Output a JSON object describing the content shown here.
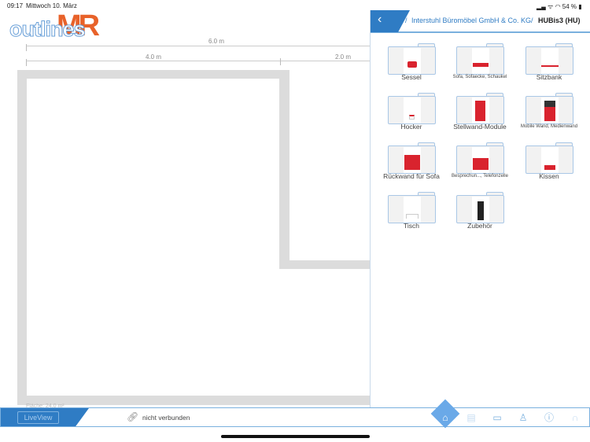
{
  "status_bar": {
    "time": "09:17",
    "date": "Mittwoch 10. März",
    "battery": "54 %"
  },
  "logo": {
    "text": "outlinesMR"
  },
  "dimensions": {
    "total": "6.0 m",
    "left": "4.0 m",
    "right": "2.0 m"
  },
  "area_label": "Fläche: 24.0 m²",
  "panel": {
    "breadcrumb": [
      "Interstuhl Büromöbel GmbH & Co. KG",
      "HUBis3 (HU)"
    ],
    "separator": "/",
    "folders": [
      {
        "label": "Sessel",
        "small": false
      },
      {
        "label": "Sofa, Sofaecke, Schaukel",
        "small": true
      },
      {
        "label": "Sitzbank",
        "small": false
      },
      {
        "label": "Hocker",
        "small": false
      },
      {
        "label": "Stellwand-Module",
        "small": false
      },
      {
        "label": "Mobile Wand, Medienwand",
        "small": true
      },
      {
        "label": "Rückwand für Sofa",
        "small": false
      },
      {
        "label": "Besprechun..., Telefonzelle",
        "small": true
      },
      {
        "label": "Kissen",
        "small": false
      },
      {
        "label": "Tisch",
        "small": false
      },
      {
        "label": "Zubehör",
        "small": false
      }
    ]
  },
  "bottom_bar": {
    "liveview": "LiveView",
    "connection": "nicht verbunden"
  },
  "colors": {
    "accent": "#2f7cc4",
    "logo_orange": "#e8622a",
    "product_red": "#d9232e"
  }
}
